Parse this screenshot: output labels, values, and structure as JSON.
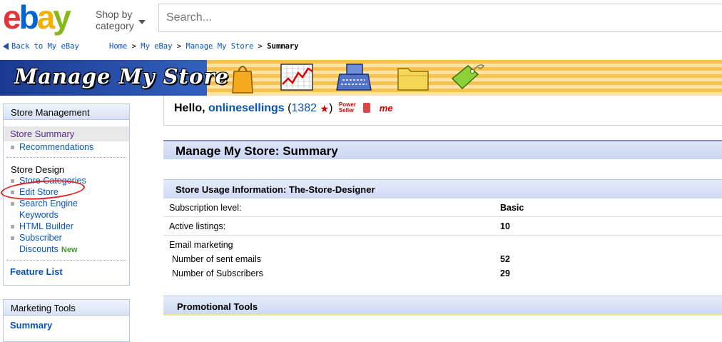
{
  "header": {
    "logo": {
      "e": "e",
      "b": "b",
      "a": "a",
      "y": "y"
    },
    "shop_by_line1": "Shop by",
    "shop_by_line2": "category",
    "search_placeholder": "Search..."
  },
  "nav": {
    "back_label": "Back to My eBay",
    "breadcrumb": [
      "Home",
      "My eBay",
      "Manage My Store",
      "Summary"
    ]
  },
  "banner": {
    "title": "Manage My Store",
    "icons": [
      "shopping-bag-icon",
      "chart-icon",
      "cash-register-icon",
      "folder-icon",
      "price-tag-icon"
    ]
  },
  "sidebar": {
    "store_management": {
      "header": "Store Management",
      "selected": "Store Summary",
      "items": [
        "Recommendations"
      ],
      "store_design_label": "Store Design",
      "design_items": [
        "Store Categories",
        "Edit Store"
      ],
      "search_engine_1": "Search Engine",
      "search_engine_2": "Keywords",
      "html_builder": "HTML Builder",
      "subscriber_1": "Subscriber",
      "subscriber_2": "Discounts",
      "new_badge": "New",
      "feature_list": "Feature List"
    },
    "marketing": {
      "header": "Marketing Tools",
      "summary": "Summary"
    }
  },
  "main": {
    "hello_prefix": "Hello,",
    "username": "onlinesellings",
    "feedback": "1382",
    "power_seller_1": "Power",
    "power_seller_2": "Seller",
    "me_badge": "me",
    "page_title": "Manage My Store: Summary",
    "usage_header": "Store Usage Information: The-Store-Designer",
    "rows": [
      {
        "label": "Subscription level:",
        "value": "Basic"
      },
      {
        "label": "Active listings:",
        "value": "10"
      }
    ],
    "email": {
      "label": "Email marketing",
      "sent_label": "Number of sent emails",
      "sent_value": "52",
      "subs_label": "Number of Subscribers",
      "subs_value": "29"
    },
    "promo_header": "Promotional Tools"
  },
  "colors": {
    "link": "#0654ba",
    "annotation": "#e02020"
  }
}
